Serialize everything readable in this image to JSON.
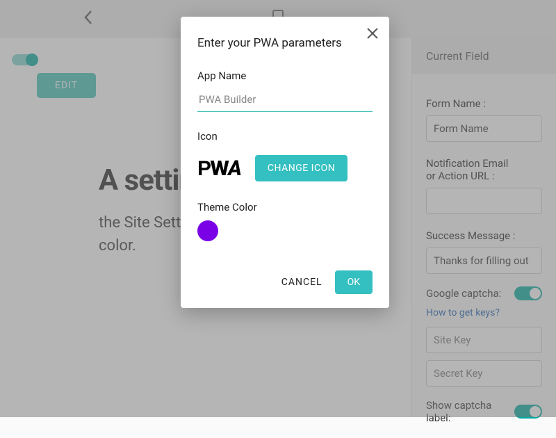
{
  "topbar": {},
  "left": {
    "edit_label": "EDIT",
    "toggle_on": true
  },
  "main": {
    "heading_fragment": "A settin",
    "text_line1": "the Site Setti",
    "text_line2": "color."
  },
  "right": {
    "tab_label": "Current Field",
    "form_name_label": "Form Name :",
    "form_name_value": "Form Name",
    "notif_label_line1": "Notification Email",
    "notif_label_line2": "or Action URL :",
    "notif_value": "",
    "success_label": "Success Message :",
    "success_value": "Thanks for filling out",
    "captcha_label": "Google captcha:",
    "captcha_on": true,
    "keys_link": "How to get keys?",
    "site_key_placeholder": "Site Key",
    "secret_key_placeholder": "Secret Key",
    "show_label_label": "Show captcha label:",
    "show_label_on": true
  },
  "modal": {
    "title": "Enter your PWA parameters",
    "app_name_label": "App Name",
    "app_name_value": "PWA Builder",
    "icon_label": "Icon",
    "change_icon_label": "CHANGE ICON",
    "theme_color_label": "Theme Color",
    "theme_color": "#7a00e6",
    "cancel_label": "CANCEL",
    "ok_label": "OK"
  }
}
